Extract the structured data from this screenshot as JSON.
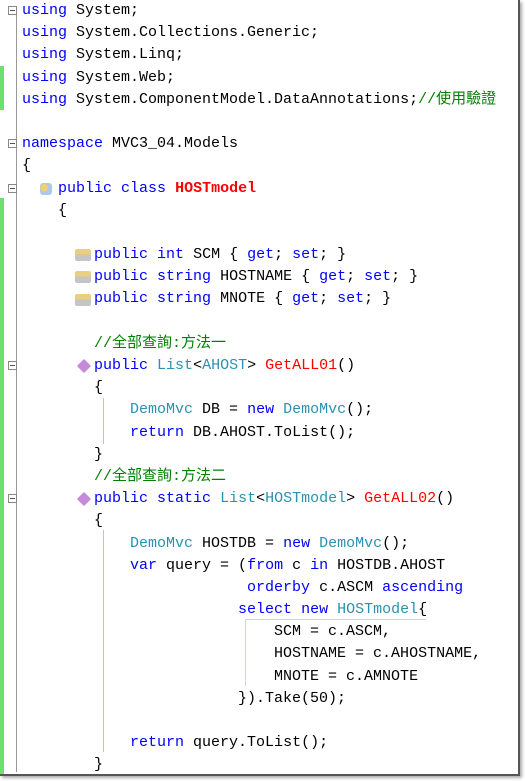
{
  "editor": {
    "colors": {
      "keyword": "#0000ff",
      "type": "#2b91af",
      "comment": "#008000",
      "highlight": "#ff0000",
      "change_bar": "#6ee06e"
    },
    "lines": [
      [
        [
          "using",
          "kw"
        ],
        [
          " System;",
          "plain"
        ]
      ],
      [
        [
          "using",
          "kw"
        ],
        [
          " System.Collections.Generic;",
          "plain"
        ]
      ],
      [
        [
          "using",
          "kw"
        ],
        [
          " System.Linq;",
          "plain"
        ]
      ],
      [
        [
          "using",
          "kw"
        ],
        [
          " System.Web;",
          "plain"
        ]
      ],
      [
        [
          "using",
          "kw"
        ],
        [
          " System.ComponentModel.DataAnnotations;",
          "plain"
        ],
        [
          "//使用驗證",
          "cm"
        ]
      ],
      [],
      [
        [
          "namespace",
          "kw"
        ],
        [
          " MVC3_04.Models",
          "plain"
        ]
      ],
      [
        [
          "{",
          "plain"
        ]
      ],
      [
        [
          "    ",
          "plain"
        ],
        [
          "public",
          "kw"
        ],
        [
          " ",
          "plain"
        ],
        [
          "class",
          "kw"
        ],
        [
          " ",
          "plain"
        ],
        [
          "HOSTmodel",
          "redb"
        ]
      ],
      [
        [
          "    {",
          "plain"
        ]
      ],
      [],
      [
        [
          "        ",
          "plain"
        ],
        [
          "public",
          "kw"
        ],
        [
          " ",
          "plain"
        ],
        [
          "int",
          "kw"
        ],
        [
          " SCM { ",
          "plain"
        ],
        [
          "get",
          "kw"
        ],
        [
          "; ",
          "plain"
        ],
        [
          "set",
          "kw"
        ],
        [
          "; }",
          "plain"
        ]
      ],
      [
        [
          "        ",
          "plain"
        ],
        [
          "public",
          "kw"
        ],
        [
          " ",
          "plain"
        ],
        [
          "string",
          "kw"
        ],
        [
          " HOSTNAME { ",
          "plain"
        ],
        [
          "get",
          "kw"
        ],
        [
          "; ",
          "plain"
        ],
        [
          "set",
          "kw"
        ],
        [
          "; }",
          "plain"
        ]
      ],
      [
        [
          "        ",
          "plain"
        ],
        [
          "public",
          "kw"
        ],
        [
          " ",
          "plain"
        ],
        [
          "string",
          "kw"
        ],
        [
          " MNOTE { ",
          "plain"
        ],
        [
          "get",
          "kw"
        ],
        [
          "; ",
          "plain"
        ],
        [
          "set",
          "kw"
        ],
        [
          "; }",
          "plain"
        ]
      ],
      [],
      [
        [
          "        ",
          "plain"
        ],
        [
          "//全部查詢:方法一",
          "cm"
        ]
      ],
      [
        [
          "        ",
          "plain"
        ],
        [
          "public",
          "kw"
        ],
        [
          " ",
          "plain"
        ],
        [
          "List",
          "type"
        ],
        [
          "<",
          "plain"
        ],
        [
          "AHOST",
          "type"
        ],
        [
          "> ",
          "plain"
        ],
        [
          "GetALL01",
          "red"
        ],
        [
          "()",
          "plain"
        ]
      ],
      [
        [
          "        {",
          "plain"
        ]
      ],
      [
        [
          "            ",
          "plain"
        ],
        [
          "DemoMvc",
          "type"
        ],
        [
          " DB = ",
          "plain"
        ],
        [
          "new",
          "kw"
        ],
        [
          " ",
          "plain"
        ],
        [
          "DemoMvc",
          "type"
        ],
        [
          "();",
          "plain"
        ]
      ],
      [
        [
          "            ",
          "plain"
        ],
        [
          "return",
          "kw"
        ],
        [
          " DB.AHOST.ToList();",
          "plain"
        ]
      ],
      [
        [
          "        }",
          "plain"
        ]
      ],
      [
        [
          "        ",
          "plain"
        ],
        [
          "//全部查詢:方法二",
          "cm"
        ]
      ],
      [
        [
          "        ",
          "plain"
        ],
        [
          "public",
          "kw"
        ],
        [
          " ",
          "plain"
        ],
        [
          "static",
          "kw"
        ],
        [
          " ",
          "plain"
        ],
        [
          "List",
          "type"
        ],
        [
          "<",
          "plain"
        ],
        [
          "HOSTmodel",
          "type"
        ],
        [
          "> ",
          "plain"
        ],
        [
          "GetALL02",
          "red"
        ],
        [
          "()",
          "plain"
        ]
      ],
      [
        [
          "        {",
          "plain"
        ]
      ],
      [
        [
          "            ",
          "plain"
        ],
        [
          "DemoMvc",
          "type"
        ],
        [
          " HOSTDB = ",
          "plain"
        ],
        [
          "new",
          "kw"
        ],
        [
          " ",
          "plain"
        ],
        [
          "DemoMvc",
          "type"
        ],
        [
          "();",
          "plain"
        ]
      ],
      [
        [
          "            ",
          "plain"
        ],
        [
          "var",
          "kw"
        ],
        [
          " query = (",
          "plain"
        ],
        [
          "from",
          "kw"
        ],
        [
          " c ",
          "plain"
        ],
        [
          "in",
          "kw"
        ],
        [
          " HOSTDB.AHOST",
          "plain"
        ]
      ],
      [
        [
          "                         ",
          "plain"
        ],
        [
          "orderby",
          "kw"
        ],
        [
          " c.ASCM ",
          "plain"
        ],
        [
          "ascending",
          "kw"
        ]
      ],
      [
        [
          "                        ",
          "plain"
        ],
        [
          "select",
          "kw"
        ],
        [
          " ",
          "plain"
        ],
        [
          "new",
          "kw"
        ],
        [
          " ",
          "plain"
        ],
        [
          "HOSTmodel",
          "type"
        ],
        [
          "{",
          "plain"
        ]
      ],
      [
        [
          "                            SCM = c.ASCM,",
          "plain"
        ]
      ],
      [
        [
          "                            HOSTNAME = c.AHOSTNAME,",
          "plain"
        ]
      ],
      [
        [
          "                            MNOTE = c.AMNOTE",
          "plain"
        ]
      ],
      [
        [
          "                        }).Take(50);",
          "plain"
        ]
      ],
      [],
      [
        [
          "            ",
          "plain"
        ],
        [
          "return",
          "kw"
        ],
        [
          " query.ToList();",
          "plain"
        ]
      ],
      [
        [
          "        }",
          "plain"
        ]
      ]
    ],
    "fold_lines": [
      0,
      6,
      8,
      16,
      22
    ],
    "icons": [
      {
        "line": 8,
        "name": "class-icon"
      },
      {
        "line": 11,
        "name": "property-icon"
      },
      {
        "line": 12,
        "name": "property-icon"
      },
      {
        "line": 13,
        "name": "property-icon"
      },
      {
        "line": 16,
        "name": "method-icon"
      },
      {
        "line": 22,
        "name": "method-icon"
      }
    ]
  }
}
